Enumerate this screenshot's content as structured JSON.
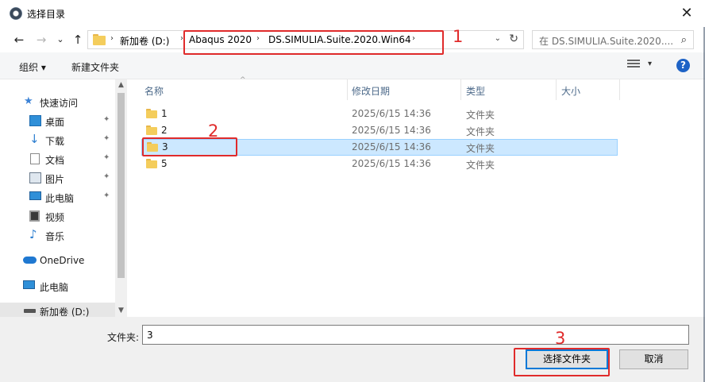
{
  "window": {
    "title": "选择目录",
    "close_glyph": "✕"
  },
  "navigation": {
    "back_glyph": "←",
    "forward_glyph": "→",
    "recent_glyph": "⌄",
    "up_glyph": "↑",
    "breadcrumb": [
      "新加卷 (D:)",
      "Abaqus 2020",
      "DS.SIMULIA.Suite.2020.Win64"
    ],
    "separator_glyph": "›",
    "dropdown_glyph": "⌄",
    "refresh_glyph": "↻",
    "search_placeholder": "在 DS.SIMULIA.Suite.2020....",
    "search_glyph": "⌕"
  },
  "toolbar": {
    "organize_label": "组织 ▾",
    "new_folder_label": "新建文件夹",
    "view_dropdown_glyph": "▾",
    "help_glyph": "?"
  },
  "sidebar": {
    "items": [
      {
        "label": "快速访问",
        "icon": "star-icon",
        "pinned": false
      },
      {
        "label": "桌面",
        "icon": "desktop-icon",
        "pinned": true
      },
      {
        "label": "下载",
        "icon": "download-icon",
        "pinned": true
      },
      {
        "label": "文档",
        "icon": "document-icon",
        "pinned": true
      },
      {
        "label": "图片",
        "icon": "picture-icon",
        "pinned": true
      },
      {
        "label": "此电脑",
        "icon": "computer-icon",
        "pinned": true
      },
      {
        "label": "视频",
        "icon": "video-icon",
        "pinned": false
      },
      {
        "label": "音乐",
        "icon": "music-icon",
        "pinned": false
      },
      {
        "label": "OneDrive",
        "icon": "cloud-icon",
        "pinned": false
      },
      {
        "label": "此电脑",
        "icon": "computer-icon",
        "pinned": false
      },
      {
        "label": "新加卷 (D:)",
        "icon": "drive-icon",
        "pinned": false,
        "selected": true
      }
    ],
    "pin_glyph": "📌"
  },
  "file_list": {
    "sort_glyph": "^",
    "columns": {
      "name": "名称",
      "date": "修改日期",
      "type": "类型",
      "size": "大小"
    },
    "rows": [
      {
        "name": "1",
        "date": "2025/6/15 14:36",
        "type": "文件夹",
        "selected": false
      },
      {
        "name": "2",
        "date": "2025/6/15 14:36",
        "type": "文件夹",
        "selected": false
      },
      {
        "name": "3",
        "date": "2025/6/15 14:36",
        "type": "文件夹",
        "selected": true
      },
      {
        "name": "5",
        "date": "2025/6/15 14:36",
        "type": "文件夹",
        "selected": false
      }
    ]
  },
  "footer": {
    "folder_label": "文件夹:",
    "folder_value": "3",
    "select_button": "选择文件夹",
    "cancel_button": "取消"
  },
  "annotations": {
    "label_1": "1",
    "label_2": "2",
    "label_3": "3",
    "color": "#e02b2b"
  },
  "colors": {
    "selection": "#cce8ff",
    "accent": "#0078d7",
    "folder": "#f4cd5c"
  }
}
